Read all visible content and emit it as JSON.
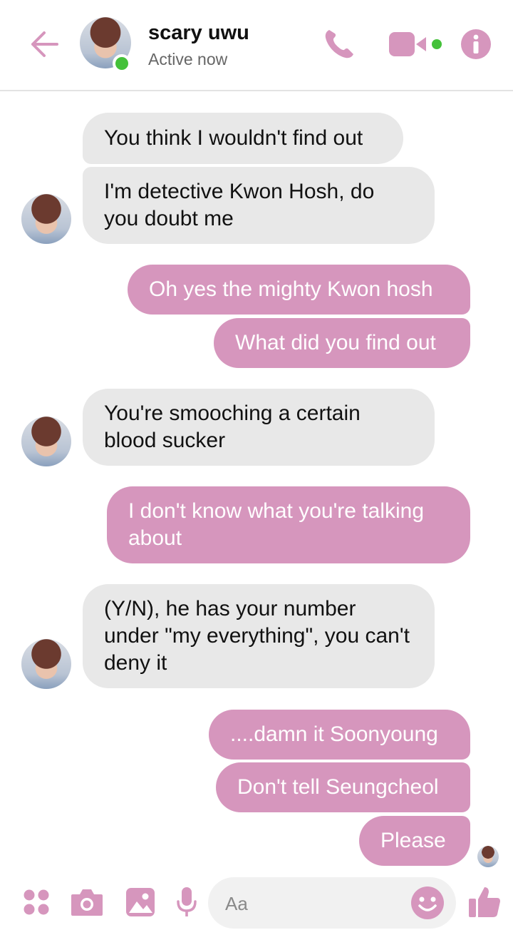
{
  "header": {
    "contact_name": "scary uwu",
    "status": "Active now",
    "accent_color": "#d696bd",
    "icons": [
      "back-arrow-icon",
      "phone-icon",
      "video-camera-icon",
      "info-icon"
    ]
  },
  "messages": [
    {
      "sender": "them",
      "text": "You think I wouldn't find out"
    },
    {
      "sender": "them",
      "text": "I'm detective Kwon Hosh, do you doubt me"
    },
    {
      "sender": "me",
      "text": "Oh yes the mighty Kwon hosh"
    },
    {
      "sender": "me",
      "text": "What did you find out"
    },
    {
      "sender": "them",
      "text": "You're smooching a certain blood sucker"
    },
    {
      "sender": "me",
      "text": "I don't know what you're talking about"
    },
    {
      "sender": "them",
      "text": "(Y/N), he has your number under \"my everything\", you can't deny it"
    },
    {
      "sender": "me",
      "text": "....damn it Soonyoung"
    },
    {
      "sender": "me",
      "text": "Don't tell Seungcheol"
    },
    {
      "sender": "me",
      "text": "Please"
    }
  ],
  "composer": {
    "placeholder": "Aa",
    "icons": [
      "apps-grid-icon",
      "camera-icon",
      "gallery-icon",
      "microphone-icon",
      "emoji-icon",
      "thumbs-up-icon"
    ]
  },
  "colors": {
    "incoming_bubble": "#e8e8e8",
    "outgoing_bubble": "#d696bd",
    "online": "#44c13a"
  }
}
